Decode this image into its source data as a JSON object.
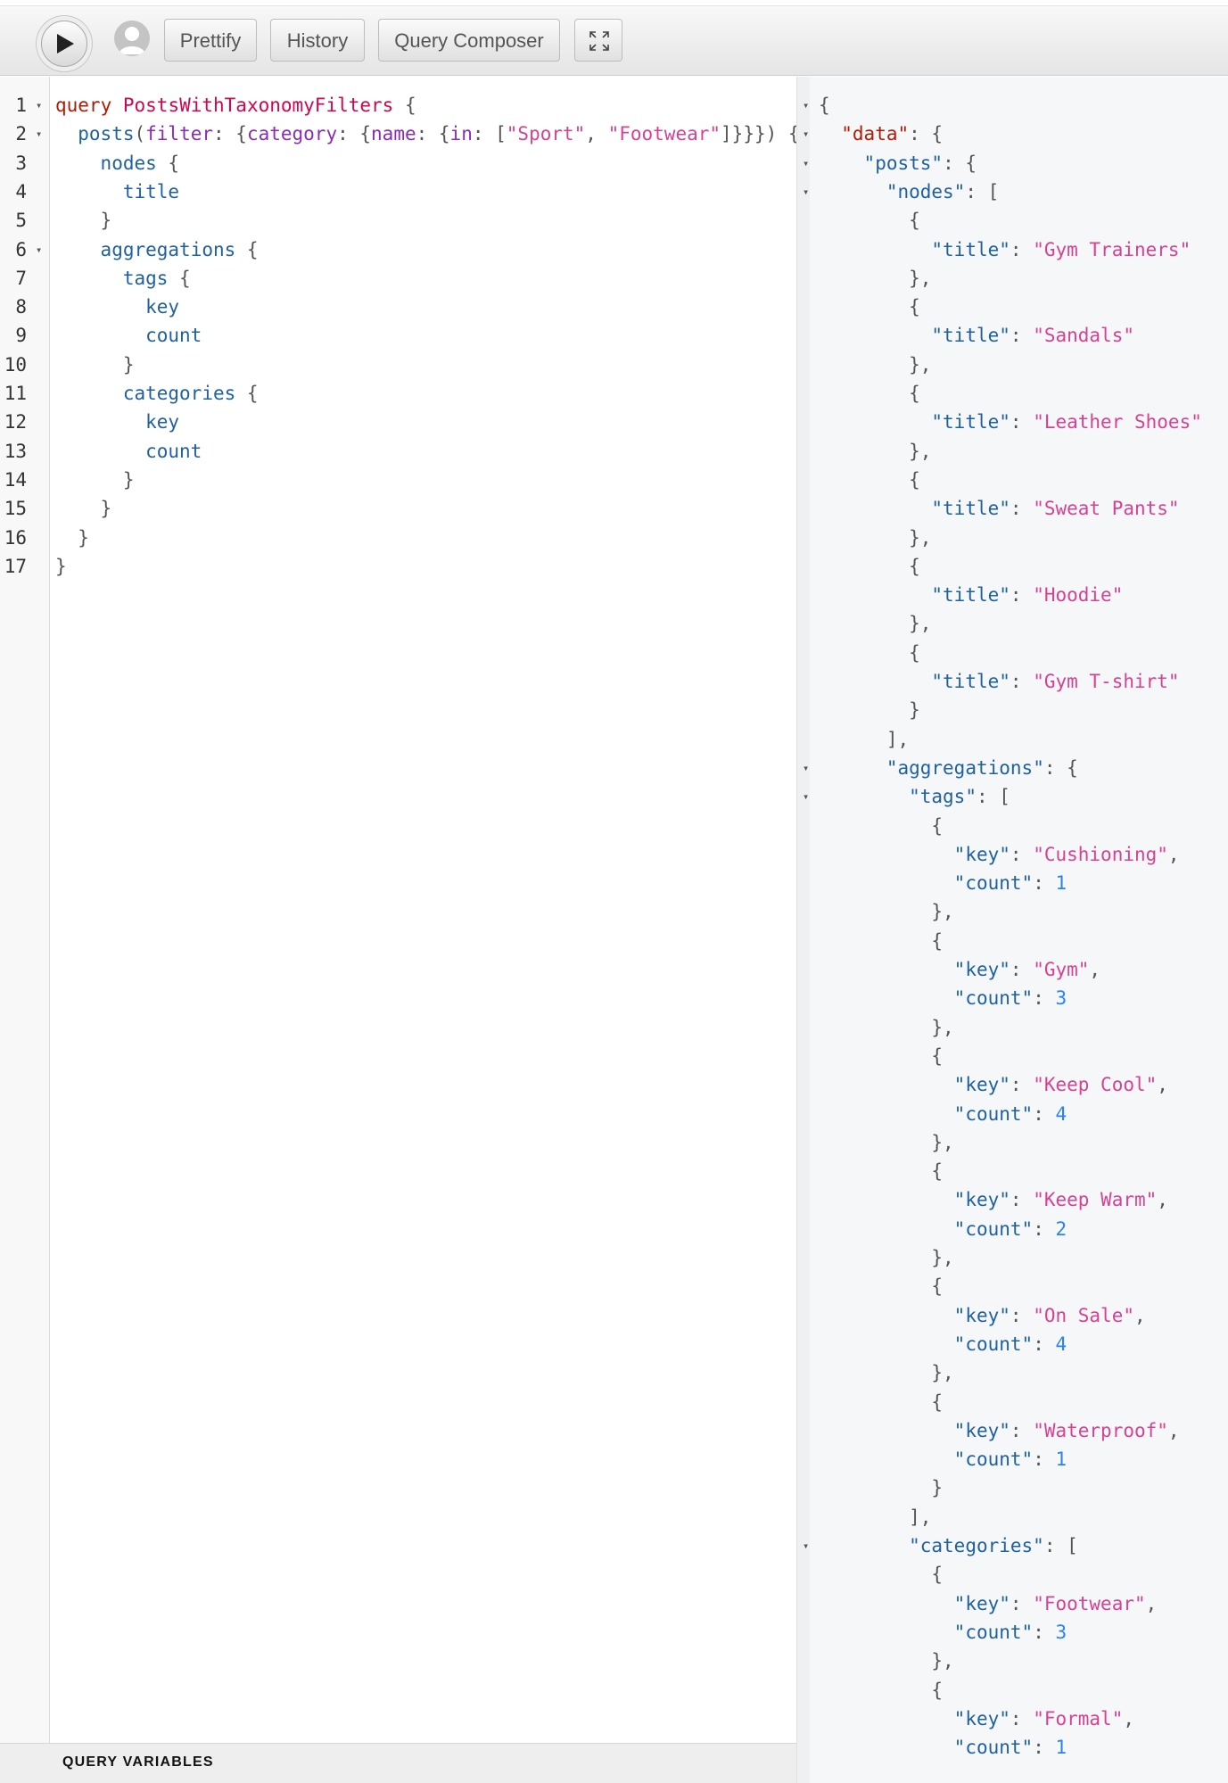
{
  "toolbar": {
    "run_label": "",
    "prettify_label": "Prettify",
    "history_label": "History",
    "composer_label": "Query Composer"
  },
  "query_editor": {
    "lines": [
      {
        "n": "1",
        "fold": true,
        "indent": 0,
        "tokens": [
          {
            "t": "query",
            "c": "kw"
          },
          {
            "t": " ",
            "c": "punct"
          },
          {
            "t": "PostsWithTaxonomyFilters",
            "c": "def"
          },
          {
            "t": " {",
            "c": "punct"
          }
        ]
      },
      {
        "n": "2",
        "fold": true,
        "indent": 1,
        "tokens": [
          {
            "t": "posts",
            "c": "prop"
          },
          {
            "t": "(",
            "c": "punct"
          },
          {
            "t": "filter",
            "c": "attr"
          },
          {
            "t": ": {",
            "c": "punct"
          },
          {
            "t": "category",
            "c": "attr"
          },
          {
            "t": ": {",
            "c": "punct"
          },
          {
            "t": "name",
            "c": "attr"
          },
          {
            "t": ": {",
            "c": "punct"
          },
          {
            "t": "in",
            "c": "attr"
          },
          {
            "t": ": [",
            "c": "punct"
          },
          {
            "t": "\"Sport\"",
            "c": "str"
          },
          {
            "t": ", ",
            "c": "punct"
          },
          {
            "t": "\"Footwear\"",
            "c": "str"
          },
          {
            "t": "]}}}) {",
            "c": "punct"
          }
        ]
      },
      {
        "n": "3",
        "fold": false,
        "indent": 2,
        "tokens": [
          {
            "t": "nodes",
            "c": "prop"
          },
          {
            "t": " {",
            "c": "punct"
          }
        ]
      },
      {
        "n": "4",
        "fold": false,
        "indent": 3,
        "tokens": [
          {
            "t": "title",
            "c": "prop"
          }
        ]
      },
      {
        "n": "5",
        "fold": false,
        "indent": 2,
        "tokens": [
          {
            "t": "}",
            "c": "punct"
          }
        ]
      },
      {
        "n": "6",
        "fold": true,
        "indent": 2,
        "tokens": [
          {
            "t": "aggregations",
            "c": "prop"
          },
          {
            "t": " {",
            "c": "punct"
          }
        ]
      },
      {
        "n": "7",
        "fold": false,
        "indent": 3,
        "tokens": [
          {
            "t": "tags",
            "c": "prop"
          },
          {
            "t": " {",
            "c": "punct"
          }
        ]
      },
      {
        "n": "8",
        "fold": false,
        "indent": 4,
        "tokens": [
          {
            "t": "key",
            "c": "prop"
          }
        ]
      },
      {
        "n": "9",
        "fold": false,
        "indent": 4,
        "tokens": [
          {
            "t": "count",
            "c": "prop"
          }
        ]
      },
      {
        "n": "10",
        "fold": false,
        "indent": 3,
        "tokens": [
          {
            "t": "}",
            "c": "punct"
          }
        ]
      },
      {
        "n": "11",
        "fold": false,
        "indent": 3,
        "tokens": [
          {
            "t": "categories",
            "c": "prop"
          },
          {
            "t": " {",
            "c": "punct"
          }
        ]
      },
      {
        "n": "12",
        "fold": false,
        "indent": 4,
        "tokens": [
          {
            "t": "key",
            "c": "prop"
          }
        ]
      },
      {
        "n": "13",
        "fold": false,
        "indent": 4,
        "tokens": [
          {
            "t": "count",
            "c": "prop"
          }
        ]
      },
      {
        "n": "14",
        "fold": false,
        "indent": 3,
        "tokens": [
          {
            "t": "}",
            "c": "punct"
          }
        ]
      },
      {
        "n": "15",
        "fold": false,
        "indent": 2,
        "tokens": [
          {
            "t": "}",
            "c": "punct"
          }
        ]
      },
      {
        "n": "16",
        "fold": false,
        "indent": 1,
        "tokens": [
          {
            "t": "}",
            "c": "punct"
          }
        ]
      },
      {
        "n": "17",
        "fold": false,
        "indent": 0,
        "tokens": [
          {
            "t": "}",
            "c": "punct"
          }
        ]
      }
    ]
  },
  "query_variables": {
    "title": "QUERY VARIABLES"
  },
  "result_viewer": {
    "lines": [
      {
        "fold": true,
        "indent": 0,
        "tokens": [
          {
            "t": "{",
            "c": "punct"
          }
        ]
      },
      {
        "fold": true,
        "indent": 1,
        "tokens": [
          {
            "t": "\"data\"",
            "c": "kw"
          },
          {
            "t": ": {",
            "c": "punct"
          }
        ]
      },
      {
        "fold": true,
        "indent": 2,
        "tokens": [
          {
            "t": "\"posts\"",
            "c": "prop"
          },
          {
            "t": ": {",
            "c": "punct"
          }
        ]
      },
      {
        "fold": true,
        "indent": 3,
        "tokens": [
          {
            "t": "\"nodes\"",
            "c": "prop"
          },
          {
            "t": ": [",
            "c": "punct"
          }
        ]
      },
      {
        "fold": false,
        "indent": 4,
        "tokens": [
          {
            "t": "{",
            "c": "punct"
          }
        ]
      },
      {
        "fold": false,
        "indent": 5,
        "tokens": [
          {
            "t": "\"title\"",
            "c": "prop"
          },
          {
            "t": ": ",
            "c": "punct"
          },
          {
            "t": "\"Gym Trainers\"",
            "c": "str"
          }
        ]
      },
      {
        "fold": false,
        "indent": 4,
        "tokens": [
          {
            "t": "},",
            "c": "punct"
          }
        ]
      },
      {
        "fold": false,
        "indent": 4,
        "tokens": [
          {
            "t": "{",
            "c": "punct"
          }
        ]
      },
      {
        "fold": false,
        "indent": 5,
        "tokens": [
          {
            "t": "\"title\"",
            "c": "prop"
          },
          {
            "t": ": ",
            "c": "punct"
          },
          {
            "t": "\"Sandals\"",
            "c": "str"
          }
        ]
      },
      {
        "fold": false,
        "indent": 4,
        "tokens": [
          {
            "t": "},",
            "c": "punct"
          }
        ]
      },
      {
        "fold": false,
        "indent": 4,
        "tokens": [
          {
            "t": "{",
            "c": "punct"
          }
        ]
      },
      {
        "fold": false,
        "indent": 5,
        "tokens": [
          {
            "t": "\"title\"",
            "c": "prop"
          },
          {
            "t": ": ",
            "c": "punct"
          },
          {
            "t": "\"Leather Shoes\"",
            "c": "str"
          }
        ]
      },
      {
        "fold": false,
        "indent": 4,
        "tokens": [
          {
            "t": "},",
            "c": "punct"
          }
        ]
      },
      {
        "fold": false,
        "indent": 4,
        "tokens": [
          {
            "t": "{",
            "c": "punct"
          }
        ]
      },
      {
        "fold": false,
        "indent": 5,
        "tokens": [
          {
            "t": "\"title\"",
            "c": "prop"
          },
          {
            "t": ": ",
            "c": "punct"
          },
          {
            "t": "\"Sweat Pants\"",
            "c": "str"
          }
        ]
      },
      {
        "fold": false,
        "indent": 4,
        "tokens": [
          {
            "t": "},",
            "c": "punct"
          }
        ]
      },
      {
        "fold": false,
        "indent": 4,
        "tokens": [
          {
            "t": "{",
            "c": "punct"
          }
        ]
      },
      {
        "fold": false,
        "indent": 5,
        "tokens": [
          {
            "t": "\"title\"",
            "c": "prop"
          },
          {
            "t": ": ",
            "c": "punct"
          },
          {
            "t": "\"Hoodie\"",
            "c": "str"
          }
        ]
      },
      {
        "fold": false,
        "indent": 4,
        "tokens": [
          {
            "t": "},",
            "c": "punct"
          }
        ]
      },
      {
        "fold": false,
        "indent": 4,
        "tokens": [
          {
            "t": "{",
            "c": "punct"
          }
        ]
      },
      {
        "fold": false,
        "indent": 5,
        "tokens": [
          {
            "t": "\"title\"",
            "c": "prop"
          },
          {
            "t": ": ",
            "c": "punct"
          },
          {
            "t": "\"Gym T-shirt\"",
            "c": "str"
          }
        ]
      },
      {
        "fold": false,
        "indent": 4,
        "tokens": [
          {
            "t": "}",
            "c": "punct"
          }
        ]
      },
      {
        "fold": false,
        "indent": 3,
        "tokens": [
          {
            "t": "],",
            "c": "punct"
          }
        ]
      },
      {
        "fold": true,
        "indent": 3,
        "tokens": [
          {
            "t": "\"aggregations\"",
            "c": "prop"
          },
          {
            "t": ": {",
            "c": "punct"
          }
        ]
      },
      {
        "fold": true,
        "indent": 4,
        "tokens": [
          {
            "t": "\"tags\"",
            "c": "prop"
          },
          {
            "t": ": [",
            "c": "punct"
          }
        ]
      },
      {
        "fold": false,
        "indent": 5,
        "tokens": [
          {
            "t": "{",
            "c": "punct"
          }
        ]
      },
      {
        "fold": false,
        "indent": 6,
        "tokens": [
          {
            "t": "\"key\"",
            "c": "prop"
          },
          {
            "t": ": ",
            "c": "punct"
          },
          {
            "t": "\"Cushioning\"",
            "c": "str"
          },
          {
            "t": ",",
            "c": "punct"
          }
        ]
      },
      {
        "fold": false,
        "indent": 6,
        "tokens": [
          {
            "t": "\"count\"",
            "c": "prop"
          },
          {
            "t": ": ",
            "c": "punct"
          },
          {
            "t": "1",
            "c": "num"
          }
        ]
      },
      {
        "fold": false,
        "indent": 5,
        "tokens": [
          {
            "t": "},",
            "c": "punct"
          }
        ]
      },
      {
        "fold": false,
        "indent": 5,
        "tokens": [
          {
            "t": "{",
            "c": "punct"
          }
        ]
      },
      {
        "fold": false,
        "indent": 6,
        "tokens": [
          {
            "t": "\"key\"",
            "c": "prop"
          },
          {
            "t": ": ",
            "c": "punct"
          },
          {
            "t": "\"Gym\"",
            "c": "str"
          },
          {
            "t": ",",
            "c": "punct"
          }
        ]
      },
      {
        "fold": false,
        "indent": 6,
        "tokens": [
          {
            "t": "\"count\"",
            "c": "prop"
          },
          {
            "t": ": ",
            "c": "punct"
          },
          {
            "t": "3",
            "c": "num"
          }
        ]
      },
      {
        "fold": false,
        "indent": 5,
        "tokens": [
          {
            "t": "},",
            "c": "punct"
          }
        ]
      },
      {
        "fold": false,
        "indent": 5,
        "tokens": [
          {
            "t": "{",
            "c": "punct"
          }
        ]
      },
      {
        "fold": false,
        "indent": 6,
        "tokens": [
          {
            "t": "\"key\"",
            "c": "prop"
          },
          {
            "t": ": ",
            "c": "punct"
          },
          {
            "t": "\"Keep Cool\"",
            "c": "str"
          },
          {
            "t": ",",
            "c": "punct"
          }
        ]
      },
      {
        "fold": false,
        "indent": 6,
        "tokens": [
          {
            "t": "\"count\"",
            "c": "prop"
          },
          {
            "t": ": ",
            "c": "punct"
          },
          {
            "t": "4",
            "c": "num"
          }
        ]
      },
      {
        "fold": false,
        "indent": 5,
        "tokens": [
          {
            "t": "},",
            "c": "punct"
          }
        ]
      },
      {
        "fold": false,
        "indent": 5,
        "tokens": [
          {
            "t": "{",
            "c": "punct"
          }
        ]
      },
      {
        "fold": false,
        "indent": 6,
        "tokens": [
          {
            "t": "\"key\"",
            "c": "prop"
          },
          {
            "t": ": ",
            "c": "punct"
          },
          {
            "t": "\"Keep Warm\"",
            "c": "str"
          },
          {
            "t": ",",
            "c": "punct"
          }
        ]
      },
      {
        "fold": false,
        "indent": 6,
        "tokens": [
          {
            "t": "\"count\"",
            "c": "prop"
          },
          {
            "t": ": ",
            "c": "punct"
          },
          {
            "t": "2",
            "c": "num"
          }
        ]
      },
      {
        "fold": false,
        "indent": 5,
        "tokens": [
          {
            "t": "},",
            "c": "punct"
          }
        ]
      },
      {
        "fold": false,
        "indent": 5,
        "tokens": [
          {
            "t": "{",
            "c": "punct"
          }
        ]
      },
      {
        "fold": false,
        "indent": 6,
        "tokens": [
          {
            "t": "\"key\"",
            "c": "prop"
          },
          {
            "t": ": ",
            "c": "punct"
          },
          {
            "t": "\"On Sale\"",
            "c": "str"
          },
          {
            "t": ",",
            "c": "punct"
          }
        ]
      },
      {
        "fold": false,
        "indent": 6,
        "tokens": [
          {
            "t": "\"count\"",
            "c": "prop"
          },
          {
            "t": ": ",
            "c": "punct"
          },
          {
            "t": "4",
            "c": "num"
          }
        ]
      },
      {
        "fold": false,
        "indent": 5,
        "tokens": [
          {
            "t": "},",
            "c": "punct"
          }
        ]
      },
      {
        "fold": false,
        "indent": 5,
        "tokens": [
          {
            "t": "{",
            "c": "punct"
          }
        ]
      },
      {
        "fold": false,
        "indent": 6,
        "tokens": [
          {
            "t": "\"key\"",
            "c": "prop"
          },
          {
            "t": ": ",
            "c": "punct"
          },
          {
            "t": "\"Waterproof\"",
            "c": "str"
          },
          {
            "t": ",",
            "c": "punct"
          }
        ]
      },
      {
        "fold": false,
        "indent": 6,
        "tokens": [
          {
            "t": "\"count\"",
            "c": "prop"
          },
          {
            "t": ": ",
            "c": "punct"
          },
          {
            "t": "1",
            "c": "num"
          }
        ]
      },
      {
        "fold": false,
        "indent": 5,
        "tokens": [
          {
            "t": "}",
            "c": "punct"
          }
        ]
      },
      {
        "fold": false,
        "indent": 4,
        "tokens": [
          {
            "t": "],",
            "c": "punct"
          }
        ]
      },
      {
        "fold": true,
        "indent": 4,
        "tokens": [
          {
            "t": "\"categories\"",
            "c": "prop"
          },
          {
            "t": ": [",
            "c": "punct"
          }
        ]
      },
      {
        "fold": false,
        "indent": 5,
        "tokens": [
          {
            "t": "{",
            "c": "punct"
          }
        ]
      },
      {
        "fold": false,
        "indent": 6,
        "tokens": [
          {
            "t": "\"key\"",
            "c": "prop"
          },
          {
            "t": ": ",
            "c": "punct"
          },
          {
            "t": "\"Footwear\"",
            "c": "str"
          },
          {
            "t": ",",
            "c": "punct"
          }
        ]
      },
      {
        "fold": false,
        "indent": 6,
        "tokens": [
          {
            "t": "\"count\"",
            "c": "prop"
          },
          {
            "t": ": ",
            "c": "punct"
          },
          {
            "t": "3",
            "c": "num"
          }
        ]
      },
      {
        "fold": false,
        "indent": 5,
        "tokens": [
          {
            "t": "},",
            "c": "punct"
          }
        ]
      },
      {
        "fold": false,
        "indent": 5,
        "tokens": [
          {
            "t": "{",
            "c": "punct"
          }
        ]
      },
      {
        "fold": false,
        "indent": 6,
        "tokens": [
          {
            "t": "\"key\"",
            "c": "prop"
          },
          {
            "t": ": ",
            "c": "punct"
          },
          {
            "t": "\"Formal\"",
            "c": "str"
          },
          {
            "t": ",",
            "c": "punct"
          }
        ]
      },
      {
        "fold": false,
        "indent": 6,
        "tokens": [
          {
            "t": "\"count\"",
            "c": "prop"
          },
          {
            "t": ": ",
            "c": "punct"
          },
          {
            "t": "1",
            "c": "num"
          }
        ]
      }
    ]
  }
}
